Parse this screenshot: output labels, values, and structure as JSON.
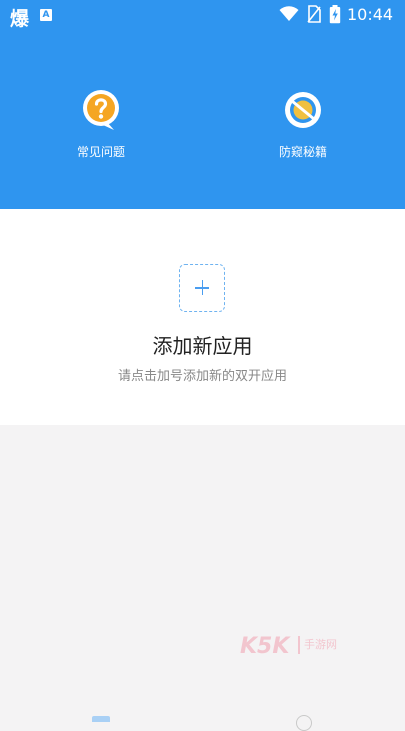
{
  "statusbar": {
    "left_glyph": "爆",
    "badge": "A",
    "time": "10:44"
  },
  "shortcuts": [
    {
      "label": "常见问题",
      "icon": "question-bubble-icon"
    },
    {
      "label": "防窥秘籍",
      "icon": "no-peek-icon"
    }
  ],
  "main": {
    "add_title": "添加新应用",
    "add_hint": "请点击加号添加新的双开应用"
  },
  "watermark": {
    "text": "K5K",
    "subtext": "手游网"
  },
  "colors": {
    "header": "#2f95ef",
    "accent": "#4a9df0",
    "faq_icon": "#f5a623",
    "background": "#f4f3f4"
  }
}
